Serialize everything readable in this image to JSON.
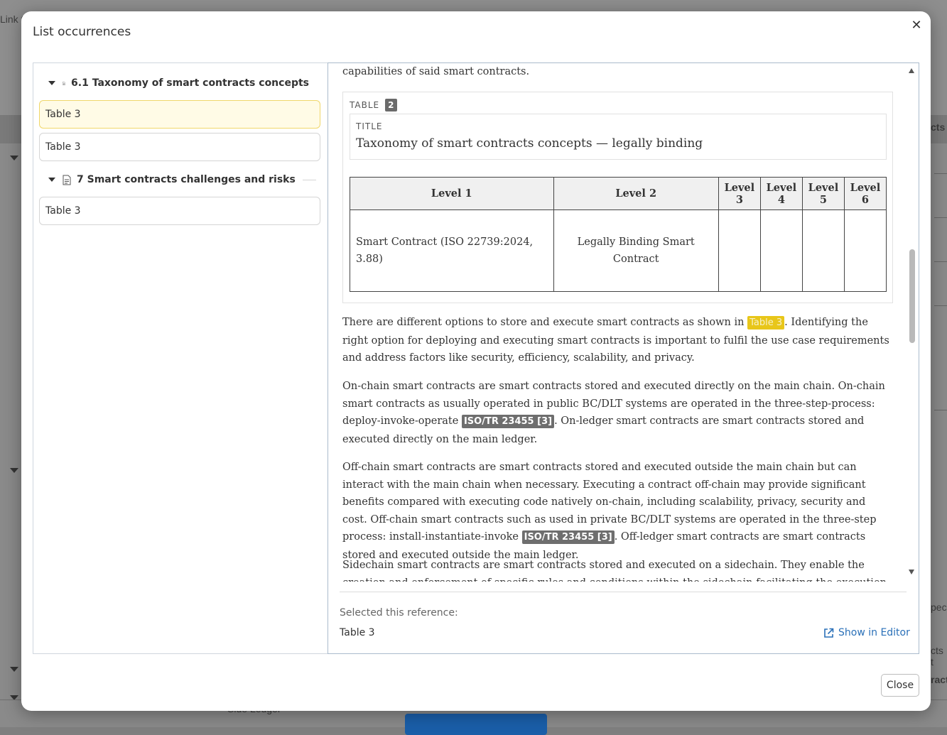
{
  "background": {
    "top_left_text": "Link t",
    "right_texts": [
      "cts",
      "pec",
      "cts t",
      "ract"
    ],
    "bottom_text": "Side Ledger"
  },
  "modal": {
    "title": "List occurrences",
    "close_icon": "close-icon",
    "close_button": "Close"
  },
  "occurrences": {
    "groups": [
      {
        "title": "6.1 Taxonomy of smart contracts concepts",
        "items": [
          "Table 3",
          "Table 3"
        ]
      },
      {
        "title": "7 Smart contracts challenges and risks",
        "items": [
          "Table 3"
        ]
      }
    ]
  },
  "preview": {
    "top_fragment": "capabilities of said smart contracts.",
    "table": {
      "label": "TABLE",
      "number": "2",
      "title_label": "TITLE",
      "title": "Taxonomy of smart contracts concepts — legally binding",
      "headers": [
        "Level 1",
        "Level 2",
        "Level 3",
        "Level 4",
        "Level 5",
        "Level 6"
      ],
      "row": [
        "Smart Contract (ISO 22739:2024, 3.88)",
        "Legally Binding Smart Contract",
        "",
        "",
        "",
        ""
      ]
    },
    "para1_before": "There are different options to store and execute smart contracts as shown in ",
    "para1_ref": "Table 3",
    "para1_after": ". Identifying the right option for deploying and executing smart contracts is important to fulfil the use case requirements and address factors like security, efficiency, scalability, and privacy.",
    "para2_before": "On-chain smart contracts are smart contracts stored and executed directly on the main chain. On-chain smart contracts as usually operated in public BC/DLT systems are operated in the three-step-process: deploy-invoke-operate ",
    "para2_ref": "ISO/TR 23455 [3]",
    "para2_after": ". On-ledger smart contracts are smart contracts stored and executed directly on the main ledger.",
    "para3_before": "Off-chain smart contracts are smart contracts stored and executed outside the main chain but can interact with the main chain when necessary. Executing a contract off-chain may provide significant benefits compared with executing code natively on-chain, including scalability, privacy, security and cost. Off-chain smart contracts such as used in private BC/DLT systems are operated in the three-step process: install-instantiate-invoke ",
    "para3_ref": "ISO/TR 23455 [3]",
    "para3_after": ". Off-ledger smart contracts are smart contracts stored and executed outside the main ledger.",
    "para4": "Sidechain smart contracts are smart contracts stored and executed on a sidechain. They enable the creation and enforcement of specific rules and conditions within the sidechain facilitating the execution of complex transactions."
  },
  "selection": {
    "label": "Selected this reference:",
    "value": "Table 3",
    "show_in_editor": "Show in Editor"
  },
  "colors": {
    "highlight": "#e8c619",
    "link": "#2a70b8",
    "selected_item_bg": "#fffbe6"
  }
}
